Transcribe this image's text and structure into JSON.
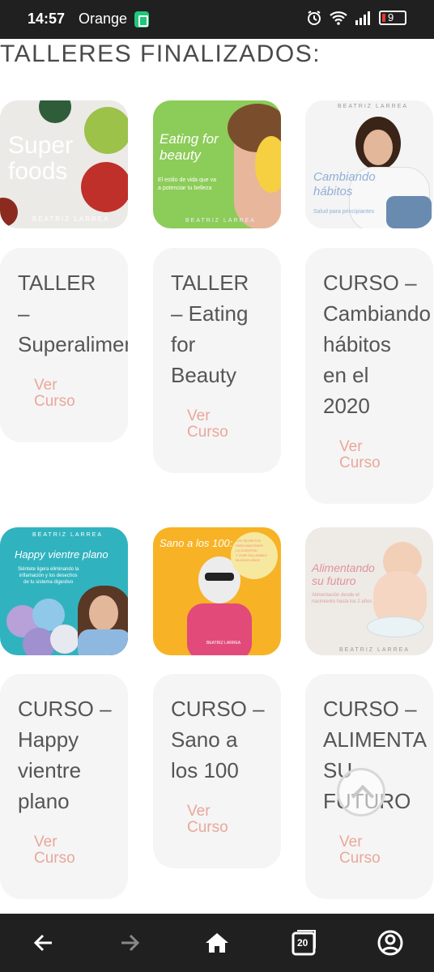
{
  "status_bar": {
    "time": "14:57",
    "carrier": "Orange",
    "battery": "9"
  },
  "section_heading": "TALLERES FINALIZADOS:",
  "courses": [
    {
      "title": "TALLER\n–\nSuperalimentos",
      "link": "Ver\nCurso",
      "thumb_text": "Super\nfoods",
      "thumb_brand": "BEATRIZ LARREA"
    },
    {
      "title": "TALLER\n– Eating\nfor\nBeauty",
      "link": "Ver\nCurso",
      "thumb_text": "Eating for\nbeauty",
      "thumb_sub": "El estilo de vida que va\na potenciar tu belleza",
      "thumb_brand": "BEATRIZ LARREA"
    },
    {
      "title": "CURSO –\nCambiando\nhábitos\nen el\n2020",
      "link": "Ver\nCurso",
      "thumb_text": "Cambiando\nhábitos",
      "thumb_sub": "Salud para principiantes",
      "thumb_brand": "BEATRIZ LARREA"
    },
    {
      "title": "CURSO –\nHappy\nvientre\nplano",
      "link": "Ver\nCurso",
      "thumb_text": "Happy vientre plano",
      "thumb_sub": "Siéntete ligera eliminando la\ninflamación y los desechos\nde tu sistema digestivo",
      "thumb_brand": "BEATRIZ LARREA"
    },
    {
      "title": "CURSO –\nSano a\nlos 100",
      "link": "Ver\nCurso",
      "thumb_text": "Sano a los 100:",
      "thumb_sub": "LOS SECRETOS\nPARA MANTENER\nLA JUVENTUD\nY VIVIR SALUDABLE\nMUCHOS AÑOS",
      "thumb_brand": "BEATRIZ LARREA"
    },
    {
      "title": "CURSO –\nALIMENTA\nSU\nFUTURO",
      "link": "Ver\nCurso",
      "thumb_text": "Alimentando\nsu futuro",
      "thumb_sub": "Alimentación desde el\nnacimiento hasta los 2 años",
      "thumb_brand": "BEATRIZ LARREA"
    }
  ],
  "nav": {
    "tabs_count": "20"
  },
  "colors": {
    "link": "#eaa79a",
    "card_bg": "#f5f5f5",
    "bar_bg": "#202020"
  }
}
